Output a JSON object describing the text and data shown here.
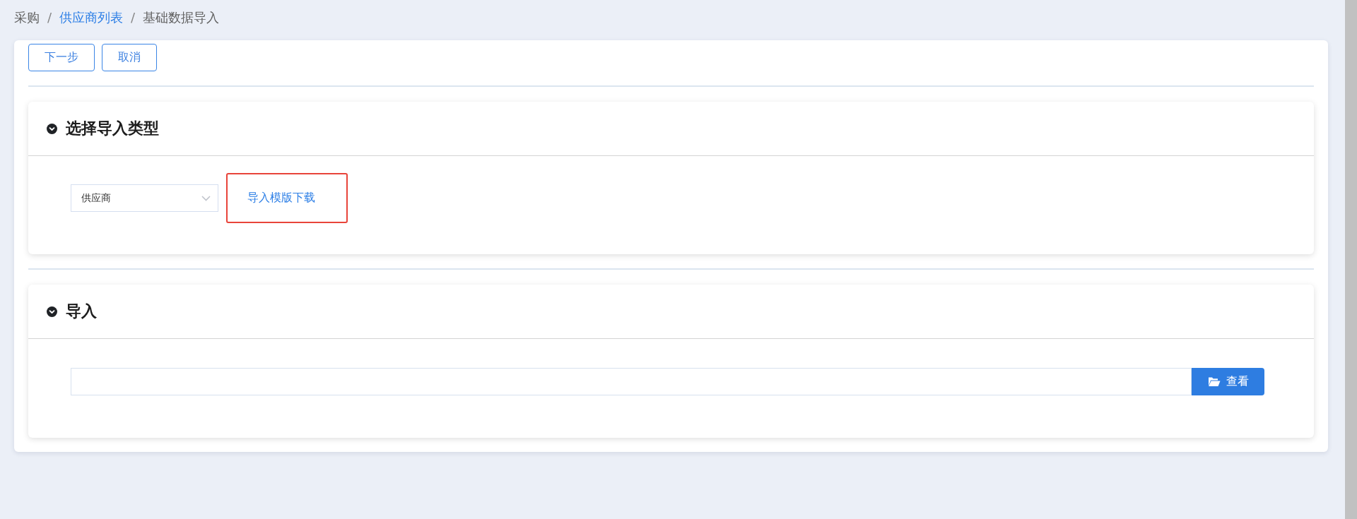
{
  "breadcrumb": {
    "separator": "/",
    "items": [
      {
        "label": "采购",
        "kind": "text"
      },
      {
        "label": "供应商列表",
        "kind": "link"
      },
      {
        "label": "基础数据导入",
        "kind": "text"
      }
    ]
  },
  "toolbar": {
    "buttons": [
      "下一步",
      "取消"
    ]
  },
  "sections": [
    {
      "title": "选择导入类型",
      "expanded": true,
      "kind": "type_select",
      "select": {
        "value": "供应商"
      },
      "link": {
        "label": "导入模版下载",
        "highlighted": true
      }
    },
    {
      "title": "导入",
      "expanded": true,
      "kind": "file_upload",
      "button": {
        "label": "查看"
      }
    }
  ]
}
